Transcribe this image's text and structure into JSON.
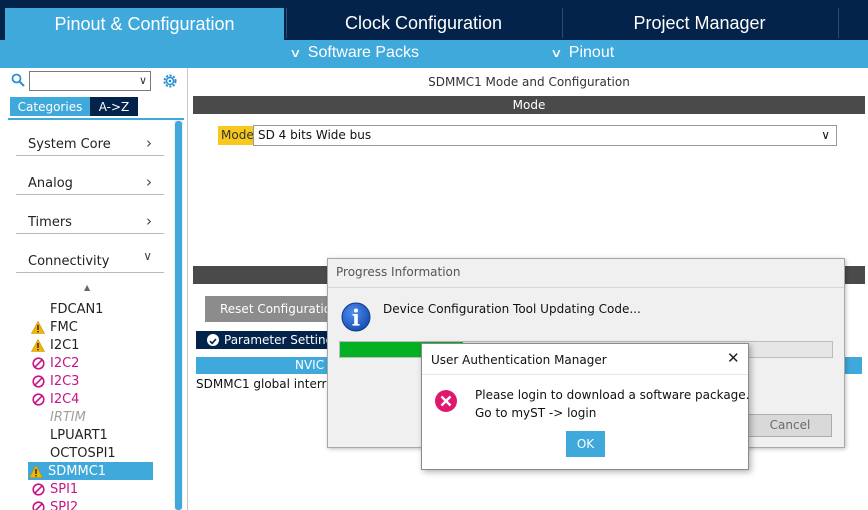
{
  "top_tabs": [
    {
      "label": "Pinout & Configuration",
      "active": true
    },
    {
      "label": "Clock Configuration"
    },
    {
      "label": "Project Manager"
    },
    {
      "label": ""
    }
  ],
  "sub_bar": {
    "software_packs": "Software Packs",
    "pinout": "Pinout"
  },
  "sidebar": {
    "search_value": "",
    "tabs": {
      "categories": "Categories",
      "az": "A->Z"
    },
    "categories": [
      {
        "label": "System Core",
        "expanded": false
      },
      {
        "label": "Analog",
        "expanded": false
      },
      {
        "label": "Timers",
        "expanded": false
      },
      {
        "label": "Connectivity",
        "expanded": true
      }
    ],
    "peripherals": [
      {
        "label": "FDCAN1",
        "status": "none"
      },
      {
        "label": "FMC",
        "status": "warning"
      },
      {
        "label": "I2C1",
        "status": "warning"
      },
      {
        "label": "I2C2",
        "status": "error"
      },
      {
        "label": "I2C3",
        "status": "error"
      },
      {
        "label": "I2C4",
        "status": "error"
      },
      {
        "label": "IRTIM",
        "status": "disabled"
      },
      {
        "label": "LPUART1",
        "status": "none"
      },
      {
        "label": "OCTOSPI1",
        "status": "none"
      },
      {
        "label": "SDMMC1",
        "status": "warning",
        "selected": true
      },
      {
        "label": "SPI1",
        "status": "error"
      },
      {
        "label": "SPI2",
        "status": "error"
      }
    ]
  },
  "main": {
    "title": "SDMMC1 Mode and Configuration",
    "mode_section": "Mode",
    "mode_label": "Mode",
    "mode_value": "SD 4 bits Wide bus",
    "reset_button": "Reset Configuration",
    "param_tab": "Parameter Settings",
    "nvic_header": "NVIC",
    "nvic_row": "SDMMC1 global interrupt"
  },
  "progress_dialog": {
    "title": "Progress Information",
    "message": "Device Configuration Tool Updating Code...",
    "progress_fraction": 0.25,
    "cancel": "Cancel"
  },
  "auth_dialog": {
    "title": "User Authentication Manager",
    "close": "✕",
    "line1": "Please login to download a software package.",
    "line2": "Go to myST -> login",
    "ok": "OK"
  },
  "colors": {
    "accent": "#3fa9db",
    "dark_navy": "#03234b",
    "progress_green": "#06b025",
    "warning": "#f7c81e",
    "error": "#c71585"
  }
}
